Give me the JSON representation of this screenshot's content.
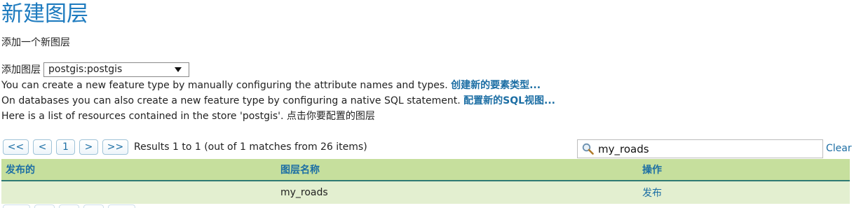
{
  "page": {
    "title": "新建图层",
    "subtitle": "添加一个新图层"
  },
  "add_layer": {
    "label": "添加图层",
    "selected_store": "postgis:postgis"
  },
  "info": {
    "line1_text": "You can create a new feature type by manually configuring the attribute names and types. ",
    "line1_link": "创建新的要素类型...",
    "line2_text": "On databases you can also create a new feature type by configuring a native SQL statement. ",
    "line2_link": "配置新的SQL视图...",
    "line3_text": "Here is a list of resources contained in the store 'postgis'. 点击你要配置的图层"
  },
  "pager": {
    "first": "<<",
    "prev": "<",
    "current": "1",
    "next": ">",
    "last": ">>",
    "results": "Results 1 to 1 (out of 1 matches from 26 items)"
  },
  "search": {
    "value": "my_roads",
    "clear_label": "Clear"
  },
  "table": {
    "headers": [
      "发布的",
      "图层名称",
      "操作"
    ],
    "rows": [
      {
        "published": "",
        "layer_name": "my_roads",
        "action": "发布"
      }
    ]
  },
  "colors": {
    "title": "#1e7bbf",
    "link": "#1c6ea4",
    "header_bg": "#c6df9d",
    "row_bg": "#e3efd0"
  }
}
